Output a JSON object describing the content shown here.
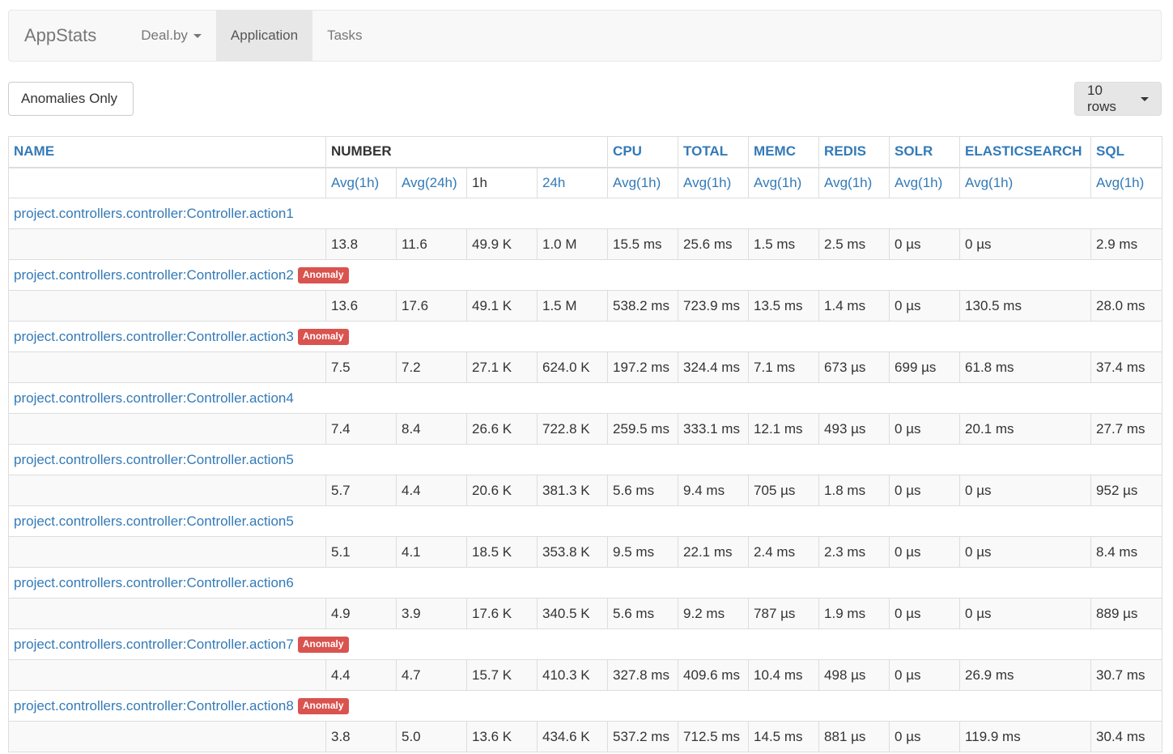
{
  "navbar": {
    "brand": "AppStats",
    "items": [
      {
        "label": "Deal.by"
      },
      {
        "label": "Application"
      },
      {
        "label": "Tasks"
      }
    ]
  },
  "toolbar": {
    "anomalies_label": "Anomalies Only",
    "rows_label": "10 rows"
  },
  "table": {
    "headers": {
      "name": "NAME",
      "number": "NUMBER",
      "cpu": "CPU",
      "total": "TOTAL",
      "memc": "MEMC",
      "redis": "REDIS",
      "solr": "SOLR",
      "elasticsearch": "ELASTICSEARCH",
      "sql": "SQL"
    },
    "subheaders": [
      "Avg(1h)",
      "Avg(24h)",
      "1h",
      "24h",
      "Avg(1h)",
      "Avg(1h)",
      "Avg(1h)",
      "Avg(1h)",
      "Avg(1h)",
      "Avg(1h)",
      "Avg(1h)"
    ],
    "anomaly_label": "Anomaly",
    "rows": [
      {
        "name": "project.controllers.controller:Controller.action1",
        "anomaly": false,
        "values": [
          "13.8",
          "11.6",
          "49.9 K",
          "1.0 M",
          "15.5 ms",
          "25.6 ms",
          "1.5 ms",
          "2.5 ms",
          "0 µs",
          "0 µs",
          "2.9 ms"
        ]
      },
      {
        "name": "project.controllers.controller:Controller.action2",
        "anomaly": true,
        "values": [
          "13.6",
          "17.6",
          "49.1 K",
          "1.5 M",
          "538.2 ms",
          "723.9 ms",
          "13.5 ms",
          "1.4 ms",
          "0 µs",
          "130.5 ms",
          "28.0 ms"
        ]
      },
      {
        "name": "project.controllers.controller:Controller.action3",
        "anomaly": true,
        "values": [
          "7.5",
          "7.2",
          "27.1 K",
          "624.0 K",
          "197.2 ms",
          "324.4 ms",
          "7.1 ms",
          "673 µs",
          "699 µs",
          "61.8 ms",
          "37.4 ms"
        ]
      },
      {
        "name": "project.controllers.controller:Controller.action4",
        "anomaly": false,
        "values": [
          "7.4",
          "8.4",
          "26.6 K",
          "722.8 K",
          "259.5 ms",
          "333.1 ms",
          "12.1 ms",
          "493 µs",
          "0 µs",
          "20.1 ms",
          "27.7 ms"
        ]
      },
      {
        "name": "project.controllers.controller:Controller.action5",
        "anomaly": false,
        "values": [
          "5.7",
          "4.4",
          "20.6 K",
          "381.3 K",
          "5.6 ms",
          "9.4 ms",
          "705 µs",
          "1.8 ms",
          "0 µs",
          "0 µs",
          "952 µs"
        ]
      },
      {
        "name": "project.controllers.controller:Controller.action5",
        "anomaly": false,
        "values": [
          "5.1",
          "4.1",
          "18.5 K",
          "353.8 K",
          "9.5 ms",
          "22.1 ms",
          "2.4 ms",
          "2.3 ms",
          "0 µs",
          "0 µs",
          "8.4 ms"
        ]
      },
      {
        "name": "project.controllers.controller:Controller.action6",
        "anomaly": false,
        "values": [
          "4.9",
          "3.9",
          "17.6 K",
          "340.5 K",
          "5.6 ms",
          "9.2 ms",
          "787 µs",
          "1.9 ms",
          "0 µs",
          "0 µs",
          "889 µs"
        ]
      },
      {
        "name": "project.controllers.controller:Controller.action7",
        "anomaly": true,
        "values": [
          "4.4",
          "4.7",
          "15.7 K",
          "410.3 K",
          "327.8 ms",
          "409.6 ms",
          "10.4 ms",
          "498 µs",
          "0 µs",
          "26.9 ms",
          "30.7 ms"
        ]
      },
      {
        "name": "project.controllers.controller:Controller.action8",
        "anomaly": true,
        "values": [
          "3.8",
          "5.0",
          "13.6 K",
          "434.6 K",
          "537.2 ms",
          "712.5 ms",
          "14.5 ms",
          "881 µs",
          "0 µs",
          "119.9 ms",
          "30.4 ms"
        ]
      }
    ]
  }
}
